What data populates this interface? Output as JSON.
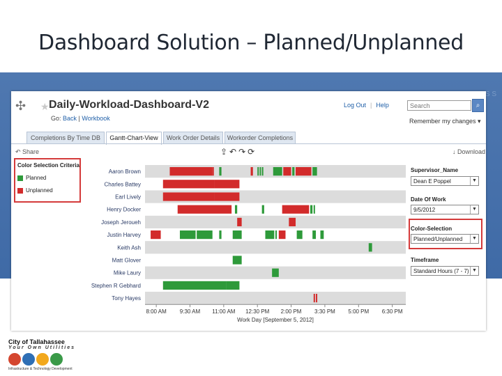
{
  "slide_title": "Dashboard Solution – Planned/Unplanned",
  "watermark": "S S",
  "header": {
    "workbook_title": "Daily-Workload-Dashboard-V2",
    "go_prefix": "Go:",
    "back": "Back",
    "workbook": "Workbook",
    "log_out": "Log Out",
    "help": "Help",
    "search_placeholder": "Search",
    "remember": "Remember my changes ▾"
  },
  "tabs": [
    {
      "label": "Completions By Time DB"
    },
    {
      "label": "Gantt-Chart-View"
    },
    {
      "label": "Work Order Details"
    },
    {
      "label": "Workorder Completions"
    }
  ],
  "toolbar": {
    "share": "Share",
    "download": "Download",
    "icons": "⇪↶↷⟳"
  },
  "legend": {
    "title": "Color Selection Criteria",
    "items": [
      {
        "label": "Planned",
        "color": "#2e9a3a"
      },
      {
        "label": "Unplanned",
        "color": "#d22b2b"
      }
    ]
  },
  "filters": [
    {
      "label": "Supervisor_Name",
      "value": "Dean E Poppel"
    },
    {
      "label": "Date Of Work",
      "value": "9/5/2012"
    },
    {
      "label": "Color-Selection",
      "value": "Planned/Unplanned"
    },
    {
      "label": "Timeframe",
      "value": "Standard Hours (7 - 7)"
    }
  ],
  "chart_data": {
    "type": "gantt",
    "xlabel": "Work Day [September 5, 2012]",
    "x_ticks": [
      "8:00 AM",
      "9:30 AM",
      "11:00 AM",
      "12:30 PM",
      "2:00 PM",
      "3:30 PM",
      "5:00 PM",
      "6:30 PM"
    ],
    "x_range_hours": [
      7.5,
      19.1
    ],
    "colors": {
      "planned": "#2e9a3a",
      "unplanned": "#d22b2b"
    },
    "rows": [
      {
        "name": "Aaron Brown",
        "segments": [
          [
            8.6,
            10.5,
            "unplanned"
          ],
          [
            10.5,
            10.55,
            "unplanned"
          ],
          [
            10.8,
            10.9,
            "planned"
          ],
          [
            12.2,
            12.3,
            "unplanned"
          ],
          [
            12.5,
            12.55,
            "planned"
          ],
          [
            12.6,
            12.65,
            "planned"
          ],
          [
            12.7,
            12.75,
            "planned"
          ],
          [
            13.2,
            13.6,
            "planned"
          ],
          [
            13.65,
            14.0,
            "unplanned"
          ],
          [
            14.05,
            14.15,
            "planned"
          ],
          [
            14.2,
            14.9,
            "unplanned"
          ],
          [
            14.95,
            15.15,
            "planned"
          ]
        ]
      },
      {
        "name": "Charles Battey",
        "segments": [
          [
            8.3,
            10.6,
            "unplanned"
          ],
          [
            10.6,
            11.7,
            "unplanned"
          ]
        ]
      },
      {
        "name": "Earl Lively",
        "segments": [
          [
            8.3,
            10.6,
            "unplanned"
          ],
          [
            10.6,
            11.7,
            "unplanned"
          ]
        ]
      },
      {
        "name": "Henry Docker",
        "segments": [
          [
            8.95,
            11.35,
            "unplanned"
          ],
          [
            11.5,
            11.6,
            "planned"
          ],
          [
            12.7,
            12.8,
            "planned"
          ],
          [
            13.6,
            14.8,
            "unplanned"
          ],
          [
            14.85,
            14.95,
            "planned"
          ],
          [
            15.0,
            15.05,
            "planned"
          ]
        ]
      },
      {
        "name": "Joseph Jeroueh",
        "segments": [
          [
            11.6,
            11.8,
            "unplanned"
          ],
          [
            13.9,
            14.2,
            "unplanned"
          ]
        ]
      },
      {
        "name": "Justin Harvey",
        "segments": [
          [
            7.75,
            8.2,
            "unplanned"
          ],
          [
            9.05,
            9.75,
            "planned"
          ],
          [
            9.8,
            10.5,
            "planned"
          ],
          [
            10.8,
            10.9,
            "planned"
          ],
          [
            11.4,
            11.8,
            "planned"
          ],
          [
            12.85,
            13.25,
            "planned"
          ],
          [
            13.3,
            13.35,
            "planned"
          ],
          [
            13.45,
            13.75,
            "unplanned"
          ],
          [
            14.25,
            14.5,
            "planned"
          ],
          [
            14.95,
            15.1,
            "planned"
          ],
          [
            15.3,
            15.45,
            "planned"
          ]
        ]
      },
      {
        "name": "Keith Ash",
        "segments": [
          [
            17.45,
            17.6,
            "planned"
          ]
        ]
      },
      {
        "name": "Matt Glover",
        "segments": [
          [
            11.4,
            11.8,
            "planned"
          ]
        ]
      },
      {
        "name": "Mike Laury",
        "segments": [
          [
            13.15,
            13.45,
            "planned"
          ]
        ]
      },
      {
        "name": "Stephen R Gebhard",
        "segments": [
          [
            8.3,
            11.1,
            "planned"
          ],
          [
            11.1,
            11.7,
            "planned"
          ]
        ]
      },
      {
        "name": "Tony Hayes",
        "segments": [
          [
            15.0,
            15.05,
            "unplanned"
          ],
          [
            15.1,
            15.15,
            "unplanned"
          ]
        ]
      }
    ]
  },
  "footer": {
    "city": "City of Tallahassee",
    "tagline": "Your Own Utilities",
    "sub": "Infrastructure & Technology Development"
  }
}
